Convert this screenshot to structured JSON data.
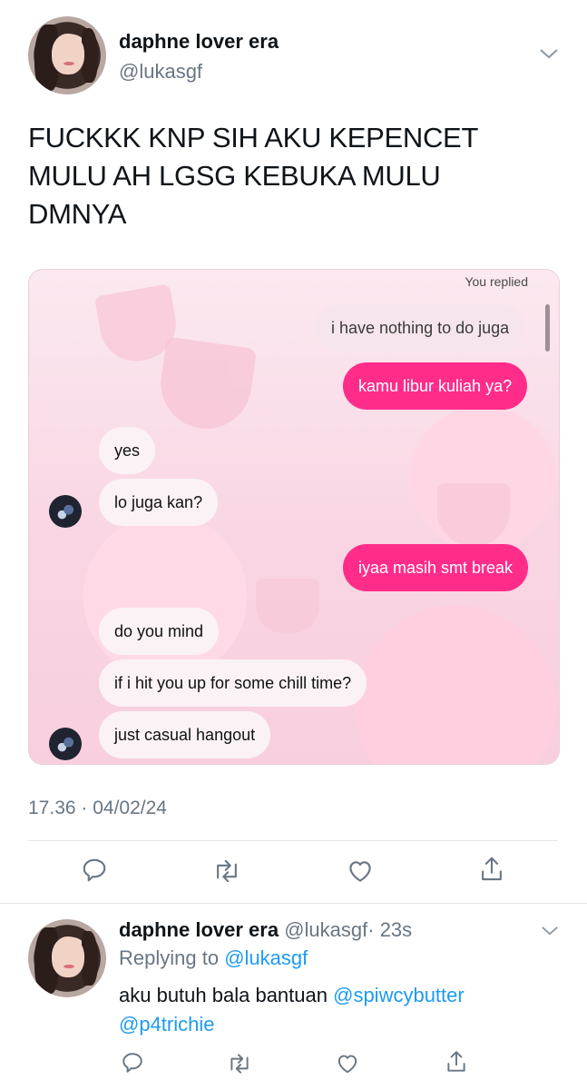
{
  "tweet": {
    "author_name": "daphne lover era",
    "author_handle": "@lukasgf",
    "text_lines": [
      "FUCKKK KNP SIH AKU KEPENCET",
      "MULU AH LGSG KEBUKA MULU",
      "DMNYA"
    ],
    "timestamp": "17.36 · 04/02/24"
  },
  "dm": {
    "replied_label": "You replied",
    "messages": [
      {
        "text": "i have nothing to do juga",
        "side": "out-light"
      },
      {
        "text": "kamu libur kuliah ya?",
        "side": "out"
      },
      {
        "text": "yes",
        "side": "in"
      },
      {
        "text": "lo juga kan?",
        "side": "in"
      },
      {
        "text": "iyaa masih smt break",
        "side": "out"
      },
      {
        "text": "do you mind",
        "side": "in"
      },
      {
        "text": "if i hit you up for some chill time?",
        "side": "in"
      },
      {
        "text": "just casual hangout",
        "side": "in"
      }
    ]
  },
  "reply": {
    "author_name": "daphne lover era",
    "author_handle": "@lukasgf",
    "age": "· 23s",
    "replying_prefix": "Replying to",
    "replying_handle": "@lukasgf",
    "text": "aku butuh bala bantuan",
    "mention1": "@spiwcybutter",
    "mention2": "@p4trichie"
  },
  "icons": [
    "chevron-down-icon",
    "reply-icon",
    "retweet-icon",
    "like-icon",
    "share-icon"
  ],
  "colors": {
    "link": "#1d9bf0",
    "outgoing_bubble": "#ff2c8a",
    "secondary_text": "#687684"
  }
}
